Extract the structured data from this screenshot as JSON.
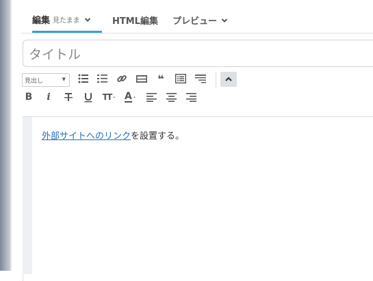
{
  "tabs": [
    {
      "label": "編集",
      "sub": "見たまま",
      "active": true
    },
    {
      "label": "HTML編集",
      "sub": "",
      "active": false
    },
    {
      "label": "プレビュー",
      "sub": "",
      "active": false
    }
  ],
  "title_field": {
    "placeholder": "タイトル",
    "value": ""
  },
  "toolbar": {
    "heading_select": "見出し",
    "tools_row1": [
      "unordered-list",
      "ordered-list",
      "link",
      "horizontal-rule",
      "blockquote",
      "table-of-contents",
      "justify"
    ],
    "tools_row2": [
      "bold",
      "italic",
      "strikethrough",
      "underline",
      "font-size",
      "text-color",
      "align-left",
      "align-center",
      "align-right"
    ],
    "italic_glyph": "i",
    "bold_glyph": "B",
    "fontsize_glyph": "TT",
    "color_glyph": "A",
    "quote_glyph": "❝"
  },
  "editor": {
    "link_text": "外部サイトへのリンク",
    "trailing_text": "を設置する。"
  },
  "colors": {
    "accent": "#3a9cd8",
    "link": "#1e6fb8"
  }
}
